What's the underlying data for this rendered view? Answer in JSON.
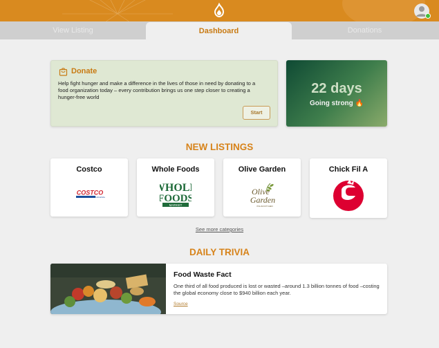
{
  "header": {
    "logo_icon": "flame-hand-icon",
    "avatar_icon": "user-avatar-icon",
    "online_status_color": "#3fbf3a",
    "brand_color": "#d98a1f"
  },
  "tabs": [
    {
      "label": "View Listing",
      "active": false
    },
    {
      "label": "Dashboard",
      "active": true
    },
    {
      "label": "Donations",
      "active": false
    }
  ],
  "donate": {
    "icon": "shopping-bag-icon",
    "title": "Donate",
    "description": "Help fight hunger and make a difference in the lives of those in need by donating to a food organization today – every contribution brings us one step closer to creating a hunger-free world",
    "button_label": "Start"
  },
  "streak": {
    "days": "22 days",
    "status": "Going strong 🔥"
  },
  "new_listings": {
    "title": "NEW LISTINGS",
    "items": [
      {
        "name": "Costco",
        "logo": "costco-logo"
      },
      {
        "name": "Whole Foods",
        "logo": "whole-foods-logo"
      },
      {
        "name": "Olive Garden",
        "logo": "olive-garden-logo"
      },
      {
        "name": "Chick Fil A",
        "logo": "chick-fil-a-logo"
      }
    ],
    "see_more": "See more categories"
  },
  "trivia": {
    "title": "DAILY TRIVIA",
    "card_title": "Food Waste Fact",
    "text": "One third of all food produced is lost or wasted –around 1.3 billion tonnes of food –costing the global economy close to $940 billion each year.",
    "source_label": "Source"
  }
}
